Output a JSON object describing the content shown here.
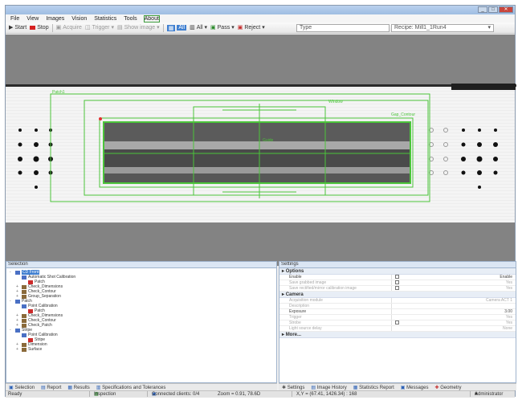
{
  "menu": [
    "File",
    "View",
    "Images",
    "Vision",
    "Statistics",
    "Tools",
    "About"
  ],
  "toolbar": {
    "start": "Start",
    "stop": "Stop",
    "acquire": "Acquire",
    "trigger": "Trigger",
    "show_image": "Show image",
    "mode_a": "All",
    "mode_b": "All",
    "pass": "Pass",
    "reject": "Reject",
    "type_label": "Type",
    "recipe": "Recipe: Mill1_1Run4"
  },
  "viewer": {
    "labels": {
      "inspection": "Patch1",
      "window": "Window",
      "gauge": "Gap_Contour",
      "guide": "Guide"
    }
  },
  "selection_panel": {
    "title": "Selection",
    "items": [
      {
        "label": "CD Front",
        "indent": 0,
        "icon": "blue",
        "expander": "-",
        "selected": true
      },
      {
        "label": "Automatic Shot Calibration",
        "indent": 1,
        "icon": "blue",
        "expander": "",
        "selected": false
      },
      {
        "label": "Patch",
        "indent": 2,
        "icon": "red",
        "expander": "",
        "selected": false
      },
      {
        "label": "Check_Dimensions",
        "indent": 1,
        "icon": "brown",
        "expander": "+",
        "selected": false
      },
      {
        "label": "Check_Contour",
        "indent": 1,
        "icon": "brown",
        "expander": "+",
        "selected": false
      },
      {
        "label": "Group_Separation",
        "indent": 1,
        "icon": "brown",
        "expander": "+",
        "selected": false
      },
      {
        "label": "Patch",
        "indent": 0,
        "icon": "blue",
        "expander": "-",
        "selected": false
      },
      {
        "label": "Point Calibration",
        "indent": 1,
        "icon": "blue",
        "expander": "",
        "selected": false
      },
      {
        "label": "Patch",
        "indent": 2,
        "icon": "red",
        "expander": "",
        "selected": false
      },
      {
        "label": "Check_Dimensions",
        "indent": 1,
        "icon": "brown",
        "expander": "+",
        "selected": false
      },
      {
        "label": "Check_Contour",
        "indent": 1,
        "icon": "brown",
        "expander": "+",
        "selected": false
      },
      {
        "label": "Check_Patch",
        "indent": 1,
        "icon": "brown",
        "expander": "+",
        "selected": false
      },
      {
        "label": "Stripe",
        "indent": 0,
        "icon": "blue",
        "expander": "-",
        "selected": false
      },
      {
        "label": "Point Calibration",
        "indent": 1,
        "icon": "blue",
        "expander": "",
        "selected": false
      },
      {
        "label": "Stripe",
        "indent": 2,
        "icon": "red",
        "expander": "",
        "selected": false
      },
      {
        "label": "Dimension",
        "indent": 1,
        "icon": "brown",
        "expander": "+",
        "selected": false
      },
      {
        "label": "Surface",
        "indent": 1,
        "icon": "brown",
        "expander": "+",
        "selected": false
      }
    ]
  },
  "settings_panel": {
    "title": "Settings",
    "groups": [
      {
        "name": "Options",
        "rows": [
          {
            "name": "Enable",
            "check": true,
            "value": "Enable",
            "dim": false
          },
          {
            "name": "Save grabbed image",
            "check": true,
            "value": "Yes",
            "dim": true
          },
          {
            "name": "Save rectified/mirror calibration image",
            "check": true,
            "value": "Yes",
            "dim": true
          }
        ]
      },
      {
        "name": "Camera",
        "rows": [
          {
            "name": "Acquisition module",
            "check": false,
            "value": "Camera ACT 1",
            "dim": true
          },
          {
            "name": "Description",
            "check": false,
            "value": "",
            "dim": true
          },
          {
            "name": "Exposure",
            "check": false,
            "value": "3.00",
            "dim": false
          },
          {
            "name": "Trigger",
            "check": false,
            "value": "Yes",
            "dim": true
          },
          {
            "name": "Strobe",
            "check": true,
            "value": "Yes",
            "dim": true
          },
          {
            "name": "Light source delay",
            "check": false,
            "value": "None",
            "dim": true
          }
        ]
      },
      {
        "name": "More...",
        "rows": []
      }
    ]
  },
  "bottom_tabs_left": [
    "Selection",
    "Report",
    "Results",
    "Specifications and Tolerances"
  ],
  "bottom_tabs_right": [
    "Settings",
    "Image History",
    "Statistics Report",
    "Messages",
    "Geometry"
  ],
  "status": {
    "ready": "Ready",
    "mode": "Inspection",
    "connection": "Connected clients: 0/4",
    "zoom": "Zoom = 0.91, 78.6D",
    "coords": "X,Y = (67.41, 1426.34) : 168",
    "user": "Administrator"
  }
}
